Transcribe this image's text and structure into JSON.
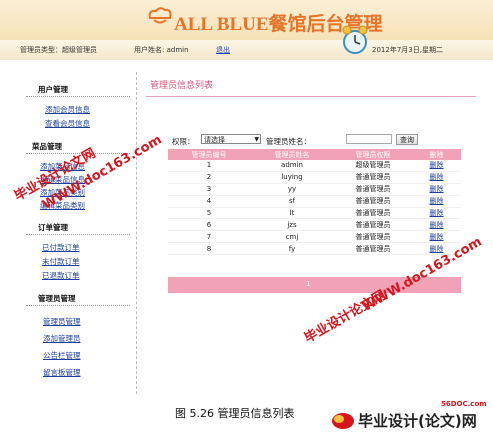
{
  "header": {
    "title": "ALL BLUE餐馆后台管理",
    "user_type_label": "管理员类型：超级管理员",
    "user_name_label": "用户姓名: admin",
    "logout_label": "退出",
    "date_text": "2012年7月3日,星期二"
  },
  "sidebar": {
    "sections": [
      {
        "title": "用户管理",
        "items": [
          "添加会员信息",
          "查看会员信息"
        ]
      },
      {
        "title": "菜品管理",
        "items": [
          "添加菜品信息",
          "编辑菜品信息",
          "添加菜品类别",
          "编辑菜品类别"
        ]
      },
      {
        "title": "订单管理",
        "items": [
          "已付款订单",
          "未付款订单",
          "已退款订单"
        ]
      },
      {
        "title": "管理员管理",
        "items": [
          "管理员管理",
          "添加管理员",
          "公告栏管理",
          "留言板管理"
        ]
      }
    ]
  },
  "main": {
    "heading": "管理员信息列表",
    "filter": {
      "role_label": "权限：",
      "role_value": "请选择",
      "name_label": "管理员姓名：",
      "name_placeholder": "",
      "query_button": "查询"
    },
    "table": {
      "columns": [
        "管理员编号",
        "管理员姓名",
        "管理员权限",
        "删除"
      ],
      "rows": [
        {
          "id": "1",
          "name": "admin",
          "role": "超级管理员",
          "action": "删除"
        },
        {
          "id": "2",
          "name": "luying",
          "role": "普通管理员",
          "action": "删除"
        },
        {
          "id": "3",
          "name": "yy",
          "role": "普通管理员",
          "action": "删除"
        },
        {
          "id": "4",
          "name": "sf",
          "role": "普通管理员",
          "action": "删除"
        },
        {
          "id": "5",
          "name": "lt",
          "role": "普通管理员",
          "action": "删除"
        },
        {
          "id": "6",
          "name": "jzs",
          "role": "普通管理员",
          "action": "删除"
        },
        {
          "id": "7",
          "name": "cmj",
          "role": "普通管理员",
          "action": "删除"
        },
        {
          "id": "8",
          "name": "fy",
          "role": "普通管理员",
          "action": "删除"
        }
      ],
      "pager_text": "1"
    }
  },
  "caption": "图 5.26 管理员信息列表",
  "watermarks": {
    "line1": "毕业设计论文网",
    "line2": "WWW.doc163.com"
  },
  "footer_logo": {
    "domain": "56DOC.com",
    "text": "毕业设计(论文)网"
  },
  "colors": {
    "title_orange": "#e8742a",
    "table_header_pink": "#f1a2b7",
    "link_blue": "#1a3f9f",
    "watermark_red": "#d8141c"
  }
}
